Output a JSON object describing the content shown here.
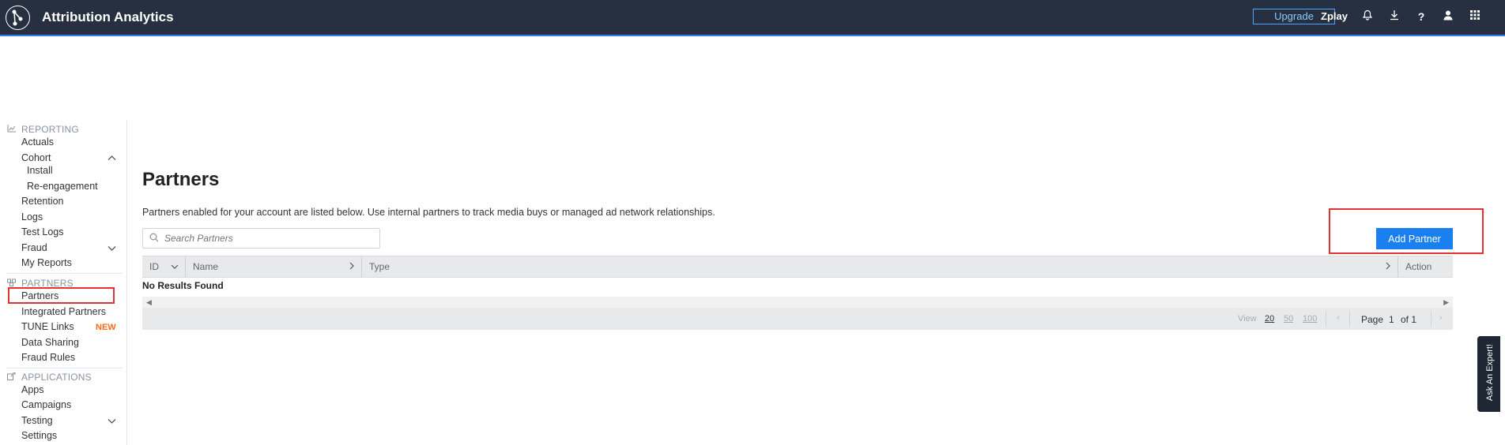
{
  "header": {
    "title": "Attribution Analytics",
    "upgrade_label": "Upgrade",
    "org_name": "Zplay",
    "icons": [
      "bell-icon",
      "download-icon",
      "help-icon",
      "user-icon",
      "apps-grid-icon"
    ]
  },
  "sidebar": {
    "reporting": {
      "heading": "REPORTING",
      "items": [
        "Actuals",
        "Cohort",
        "Install",
        "Re-engagement",
        "Retention",
        "Logs",
        "Test Logs",
        "Fraud",
        "My Reports"
      ]
    },
    "partners": {
      "heading": "PARTNERS",
      "items": [
        "Partners",
        "Integrated Partners",
        "TUNE Links",
        "Data Sharing",
        "Fraud Rules"
      ],
      "new_badge": "NEW"
    },
    "applications": {
      "heading": "APPLICATIONS",
      "items": [
        "Apps",
        "Campaigns",
        "Testing",
        "Settings"
      ]
    }
  },
  "main": {
    "title": "Partners",
    "description": "Partners enabled for your account are listed below. Use internal partners to track media buys or managed ad network relationships.",
    "search_placeholder": "Search Partners",
    "add_button": "Add Partner",
    "columns": [
      "ID",
      "Name",
      "Type",
      "Action"
    ],
    "no_results": "No Results Found",
    "pager": {
      "view_label": "View",
      "sizes": [
        "20",
        "50",
        "100"
      ],
      "selected_size": "20",
      "page_label": "Page",
      "page": "1",
      "of_label": "of 1"
    }
  },
  "ask_expert": "Ask An Expert!",
  "colors": {
    "topbar": "#263040",
    "accent": "#1a7fef",
    "highlight": "#e23333",
    "new_badge": "#ff6a13"
  }
}
